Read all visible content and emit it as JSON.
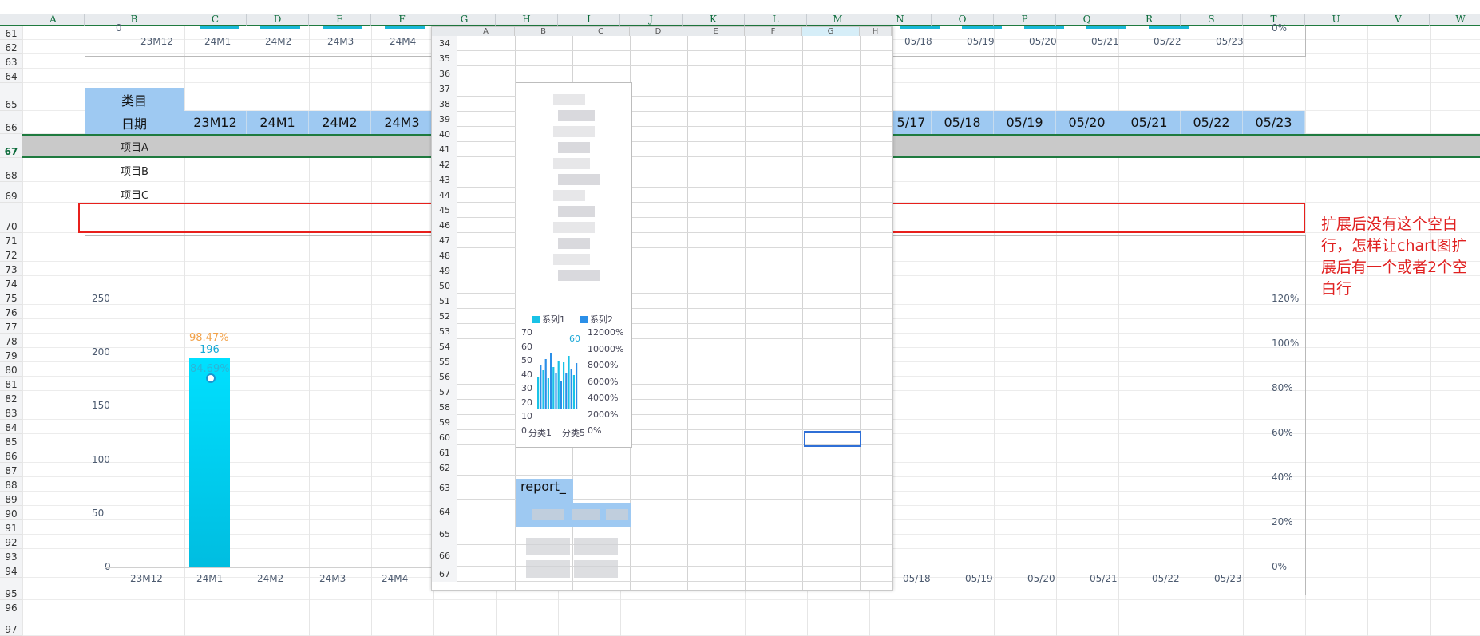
{
  "columns": [
    "A",
    "B",
    "C",
    "D",
    "E",
    "F",
    "G",
    "H",
    "I",
    "J",
    "K",
    "L",
    "M",
    "N",
    "O",
    "P",
    "Q",
    "R",
    "S",
    "T",
    "U",
    "V",
    "W"
  ],
  "rows": [
    "61",
    "62",
    "63",
    "64",
    "65",
    "66",
    "67",
    "68",
    "69",
    "70",
    "71",
    "72",
    "73",
    "74",
    "75",
    "76",
    "77",
    "78",
    "79",
    "80",
    "81",
    "82",
    "83",
    "84",
    "85",
    "86",
    "87",
    "88",
    "89",
    "90",
    "91",
    "92",
    "93",
    "94",
    "95",
    "96",
    "97"
  ],
  "table": {
    "category_label": "类目",
    "date_label": "日期",
    "left_dates": [
      "23M12",
      "24M1",
      "24M2",
      "24M3"
    ],
    "right_dates": [
      "5/17",
      "05/18",
      "05/19",
      "05/20",
      "05/21",
      "05/22",
      "05/23"
    ],
    "items": [
      "项目A",
      "项目B",
      "项目C"
    ]
  },
  "top_chart": {
    "axis_zero": "0",
    "axis_zero_right": "0%",
    "left_ticks": [
      "23M12",
      "24M1",
      "24M2",
      "24M3",
      "24M4"
    ],
    "right_ticks": [
      "05/18",
      "05/19",
      "05/20",
      "05/21",
      "05/22",
      "05/23"
    ]
  },
  "main_chart": {
    "y_ticks": [
      "250",
      "200",
      "150",
      "100",
      "50",
      "0"
    ],
    "y2_ticks": [
      "120%",
      "100%",
      "80%",
      "60%",
      "40%",
      "20%",
      "0%"
    ],
    "x_left": [
      "23M12",
      "24M1",
      "24M2",
      "24M3",
      "24M4"
    ],
    "x_right": [
      "05/18",
      "05/19",
      "05/20",
      "05/21",
      "05/22",
      "05/23"
    ],
    "bar_value_label": "196",
    "pct_label_1": "98.47%",
    "pct_label_2": "84.69%",
    "bar_color": "#00c8ec"
  },
  "popup": {
    "columns": [
      "A",
      "B",
      "C",
      "D",
      "E",
      "F",
      "G",
      "H"
    ],
    "rows": [
      "34",
      "35",
      "36",
      "37",
      "38",
      "39",
      "40",
      "41",
      "42",
      "43",
      "44",
      "45",
      "46",
      "47",
      "48",
      "49",
      "50",
      "51",
      "52",
      "53",
      "54",
      "55",
      "56",
      "57",
      "58",
      "59",
      "60",
      "61",
      "62",
      "63",
      "64",
      "65",
      "66",
      "67"
    ],
    "mini_chart": {
      "legend": [
        "系列1",
        "系列2"
      ],
      "y_ticks": [
        "70",
        "60",
        "50",
        "40",
        "30",
        "20",
        "10",
        "0"
      ],
      "y2_ticks": [
        "12000%",
        "10000%",
        "8000%",
        "6000%",
        "4000%",
        "2000%",
        "0%"
      ],
      "x_ticks": [
        "分类1",
        "分类5"
      ],
      "top_label": "60"
    },
    "report_label": "report_"
  },
  "annotation": "扩展后没有这个空白行，怎样让chart图扩展后有一个或者2个空白行"
}
